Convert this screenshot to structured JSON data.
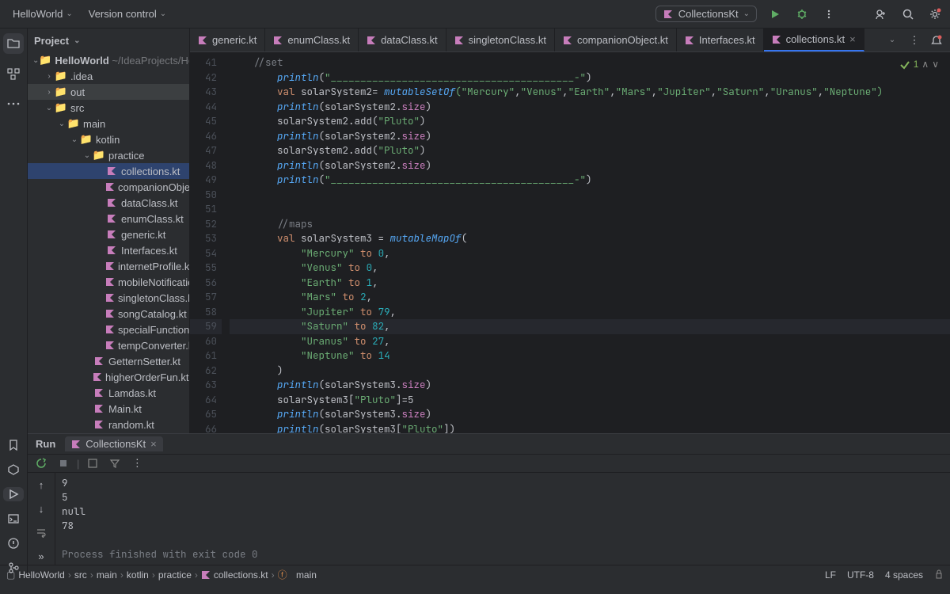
{
  "top": {
    "project": "HelloWorld",
    "menu2": "Version control",
    "runConfig": "CollectionsKt"
  },
  "projectPanel": {
    "title": "Project"
  },
  "tree": {
    "root": "HelloWorld",
    "rootPath": "~/IdeaProjects/Hell…",
    "idea": ".idea",
    "out": "out",
    "src": "src",
    "main": "main",
    "kotlin": "kotlin",
    "practice": "practice",
    "files": {
      "collections": "collections.kt",
      "companionObject": "companionObje…",
      "dataClass": "dataClass.kt",
      "enumClass": "enumClass.kt",
      "generic": "generic.kt",
      "interfaces": "Interfaces.kt",
      "internetProfile": "internetProfile.k…",
      "mobileNotification": "mobileNotificatio…",
      "singletonClass": "singletonClass.k…",
      "songCatalog": "songCatalog.kt",
      "specialFunction": "specialFunction.…",
      "tempConverter": "tempConverter.k…",
      "getterSetter": "GetternSetter.kt",
      "higherOrderFun": "higherOrderFun.kt",
      "lamdas": "Lamdas.kt",
      "main2": "Main.kt",
      "random": "random.kt"
    }
  },
  "tabs": {
    "t0": "generic.kt",
    "t1": "enumClass.kt",
    "t2": "dataClass.kt",
    "t3": "singletonClass.kt",
    "t4": "companionObject.kt",
    "t5": "Interfaces.kt",
    "t6": "collections.kt"
  },
  "indicator": "1",
  "gutter": {
    "s": 41,
    "e": 66
  },
  "runPanel": {
    "title": "Run",
    "tab": "CollectionsKt",
    "out1": "9",
    "out2": "5",
    "out3": "null",
    "out4": "78",
    "exit": "Process finished with exit code 0"
  },
  "breadcrumbs": {
    "b0": "HelloWorld",
    "b1": "src",
    "b2": "main",
    "b3": "kotlin",
    "b4": "practice",
    "b5": "collections.kt",
    "b6": "main"
  },
  "status": {
    "lf": "LF",
    "enc": "UTF-8",
    "indent": "4 spaces"
  },
  "code": {
    "l41": "//set",
    "divider": "\"_________________________________________-\"",
    "kw_val": "val",
    "ss2_decl": "solarSystem2= ",
    "mset": "mutableSetOf",
    "planets": "(\"Mercury\",\"Venus\",\"Earth\",\"Mars\",\"Jupiter\",\"Saturn\",\"Uranus\",\"Neptune\")",
    "println": "println",
    "ss2_size": "(solarSystem2.",
    "size": "size",
    "add_pluto": "solarSystem2.add(",
    "pluto": "\"Pluto\"",
    "maps": "//maps",
    "ss3_decl": "solarSystem3 = ",
    "mmap": "mutableMapOf",
    "to": "to",
    "mercury": "\"Mercury\"",
    "venus": "\"Venus\"",
    "earth": "\"Earth\"",
    "mars": "\"Mars\"",
    "jupiter": "\"Jupiter\"",
    "saturn": "\"Saturn\"",
    "uranus": "\"Uranus\"",
    "neptune": "\"Neptune\"",
    "ss3_size": "(solarSystem3.",
    "ss3_pluto": "solarSystem3[",
    "eq5": "]=5",
    "ss3_get": "(solarSystem3[",
    "n0": "0",
    "n1": "1",
    "n2": "2",
    "n79": "79",
    "n82": "82",
    "n27": "27",
    "n14": "14"
  }
}
